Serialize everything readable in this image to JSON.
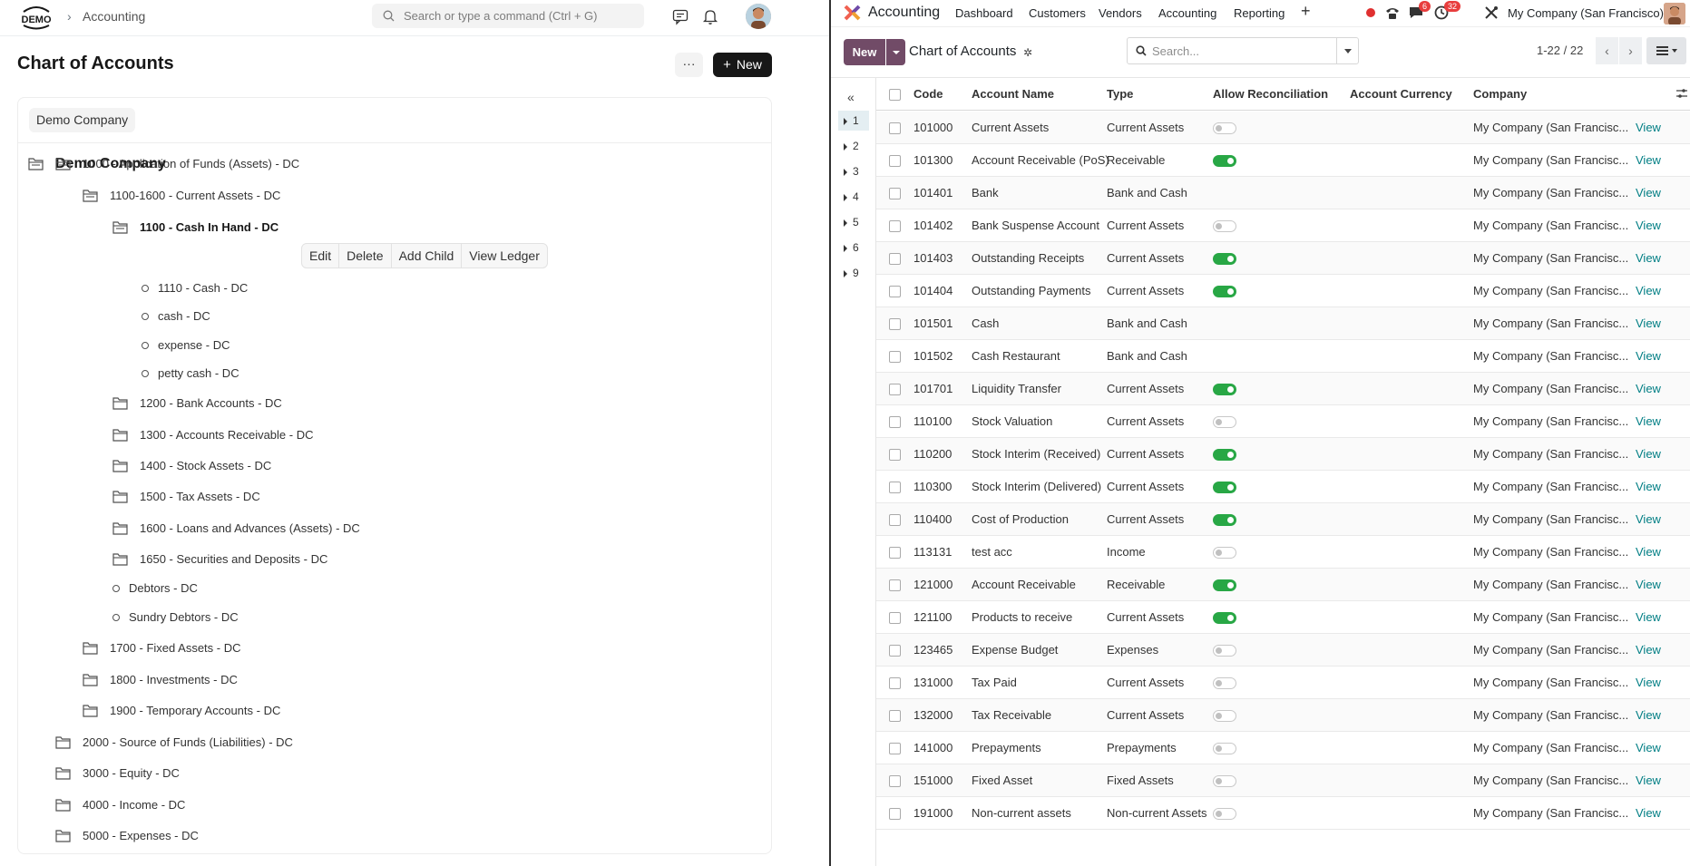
{
  "left": {
    "nav": {
      "logo_text": "DEMO",
      "breadcrumb": "Accounting",
      "search_placeholder": "Search or type a command (Ctrl + G)"
    },
    "page_title": "Chart of Accounts",
    "more_label": "···",
    "new_label": "New",
    "filter_company": "Demo Company",
    "tree": {
      "root": "Demo Company",
      "nodes": [
        "1000 - Application of Funds (Assets) - DC",
        "1100-1600 - Current Assets - DC",
        "1100 - Cash In Hand - DC",
        "1110 - Cash - DC",
        "cash - DC",
        "expense - DC",
        "petty cash - DC",
        "1200 - Bank Accounts - DC",
        "1300 - Accounts Receivable - DC",
        "1400 - Stock Assets - DC",
        "1500 - Tax Assets - DC",
        "1600 - Loans and Advances (Assets) - DC",
        "1650 - Securities and Deposits - DC",
        "Debtors - DC",
        "Sundry Debtors - DC",
        "1700 - Fixed Assets - DC",
        "1800 - Investments - DC",
        "1900 - Temporary Accounts - DC",
        "2000 - Source of Funds (Liabilities) - DC",
        "3000 - Equity - DC",
        "4000 - Income - DC",
        "5000 - Expenses - DC"
      ],
      "actions": [
        "Edit",
        "Delete",
        "Add Child",
        "View Ledger"
      ]
    }
  },
  "right": {
    "nav": {
      "app_name": "Accounting",
      "menu": [
        "Dashboard",
        "Customers",
        "Vendors",
        "Accounting",
        "Reporting"
      ],
      "plus": "+",
      "chat_badge": "6",
      "activity_badge": "32",
      "company": "My Company (San Francisco)"
    },
    "control": {
      "new_label": "New",
      "breadcrumb": "Chart of Accounts",
      "search_placeholder": "Search...",
      "pager": "1-22 / 22"
    },
    "sidebar": {
      "groups": [
        "1",
        "2",
        "3",
        "4",
        "5",
        "6",
        "9"
      ]
    },
    "table": {
      "headers": [
        "Code",
        "Account Name",
        "Type",
        "Allow Reconciliation",
        "Account Currency",
        "Company"
      ],
      "view_label": "View",
      "rows": [
        {
          "code": "101000",
          "name": "Current Assets",
          "type": "Current Assets",
          "recon": "off",
          "company": "My Company (San Francisc..."
        },
        {
          "code": "101300",
          "name": "Account Receivable (PoS)",
          "type": "Receivable",
          "recon": "on",
          "company": "My Company (San Francisc..."
        },
        {
          "code": "101401",
          "name": "Bank",
          "type": "Bank and Cash",
          "recon": "none",
          "company": "My Company (San Francisc..."
        },
        {
          "code": "101402",
          "name": "Bank Suspense Account",
          "type": "Current Assets",
          "recon": "off",
          "company": "My Company (San Francisc..."
        },
        {
          "code": "101403",
          "name": "Outstanding Receipts",
          "type": "Current Assets",
          "recon": "on",
          "company": "My Company (San Francisc..."
        },
        {
          "code": "101404",
          "name": "Outstanding Payments",
          "type": "Current Assets",
          "recon": "on",
          "company": "My Company (San Francisc..."
        },
        {
          "code": "101501",
          "name": "Cash",
          "type": "Bank and Cash",
          "recon": "none",
          "company": "My Company (San Francisc..."
        },
        {
          "code": "101502",
          "name": "Cash Restaurant",
          "type": "Bank and Cash",
          "recon": "none",
          "company": "My Company (San Francisc..."
        },
        {
          "code": "101701",
          "name": "Liquidity Transfer",
          "type": "Current Assets",
          "recon": "on",
          "company": "My Company (San Francisc..."
        },
        {
          "code": "110100",
          "name": "Stock Valuation",
          "type": "Current Assets",
          "recon": "off",
          "company": "My Company (San Francisc..."
        },
        {
          "code": "110200",
          "name": "Stock Interim (Received)",
          "type": "Current Assets",
          "recon": "on",
          "company": "My Company (San Francisc..."
        },
        {
          "code": "110300",
          "name": "Stock Interim (Delivered)",
          "type": "Current Assets",
          "recon": "on",
          "company": "My Company (San Francisc..."
        },
        {
          "code": "110400",
          "name": "Cost of Production",
          "type": "Current Assets",
          "recon": "on",
          "company": "My Company (San Francisc..."
        },
        {
          "code": "113131",
          "name": "test acc",
          "type": "Income",
          "recon": "off",
          "company": "My Company (San Francisc..."
        },
        {
          "code": "121000",
          "name": "Account Receivable",
          "type": "Receivable",
          "recon": "on",
          "company": "My Company (San Francisc..."
        },
        {
          "code": "121100",
          "name": "Products to receive",
          "type": "Current Assets",
          "recon": "on",
          "company": "My Company (San Francisc..."
        },
        {
          "code": "123465",
          "name": "Expense Budget",
          "type": "Expenses",
          "recon": "off",
          "company": "My Company (San Francisc..."
        },
        {
          "code": "131000",
          "name": "Tax Paid",
          "type": "Current Assets",
          "recon": "off",
          "company": "My Company (San Francisc..."
        },
        {
          "code": "132000",
          "name": "Tax Receivable",
          "type": "Current Assets",
          "recon": "off",
          "company": "My Company (San Francisc..."
        },
        {
          "code": "141000",
          "name": "Prepayments",
          "type": "Prepayments",
          "recon": "off",
          "company": "My Company (San Francisc..."
        },
        {
          "code": "151000",
          "name": "Fixed Asset",
          "type": "Fixed Assets",
          "recon": "off",
          "company": "My Company (San Francisc..."
        },
        {
          "code": "191000",
          "name": "Non-current assets",
          "type": "Non-current Assets",
          "recon": "off",
          "company": "My Company (San Francisc..."
        }
      ]
    }
  }
}
